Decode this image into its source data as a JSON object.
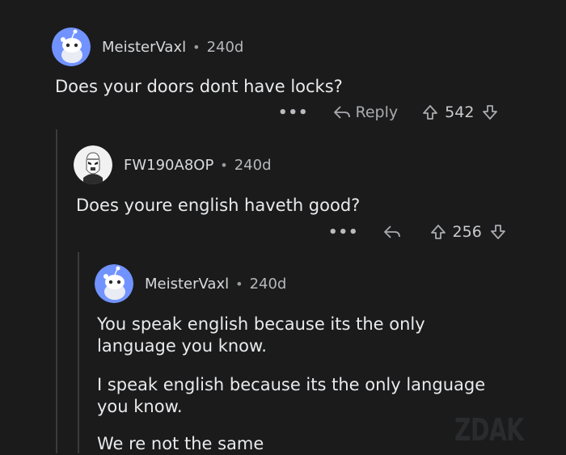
{
  "comments": [
    {
      "username": "MeisterVaxl",
      "separator": "•",
      "age": "240d",
      "body": [
        "Does your doors dont have locks?"
      ],
      "actions": {
        "more": "•••",
        "reply_label": "Reply",
        "votes": "542"
      }
    },
    {
      "username": "FW190A8OP",
      "separator": "•",
      "age": "240d",
      "body": [
        "Does youre english haveth good?"
      ],
      "actions": {
        "more": "•••",
        "reply_label": "",
        "votes": "256"
      }
    },
    {
      "username": "MeisterVaxl",
      "separator": "•",
      "age": "240d",
      "body": [
        "You speak english because its the only",
        "language you know.",
        "I speak english because its the only language",
        "you know.",
        "We re not the same"
      ]
    }
  ],
  "watermark": "ZDAK",
  "colors": {
    "background": "#1b1b1c",
    "avatar_blue": "#7193ff",
    "text": "#e8eaec",
    "meta": "#b6b8bb"
  },
  "icons": [
    "snoo-avatar",
    "stormtrooper-avatar",
    "more-icon",
    "reply-icon",
    "upvote-icon",
    "downvote-icon"
  ]
}
